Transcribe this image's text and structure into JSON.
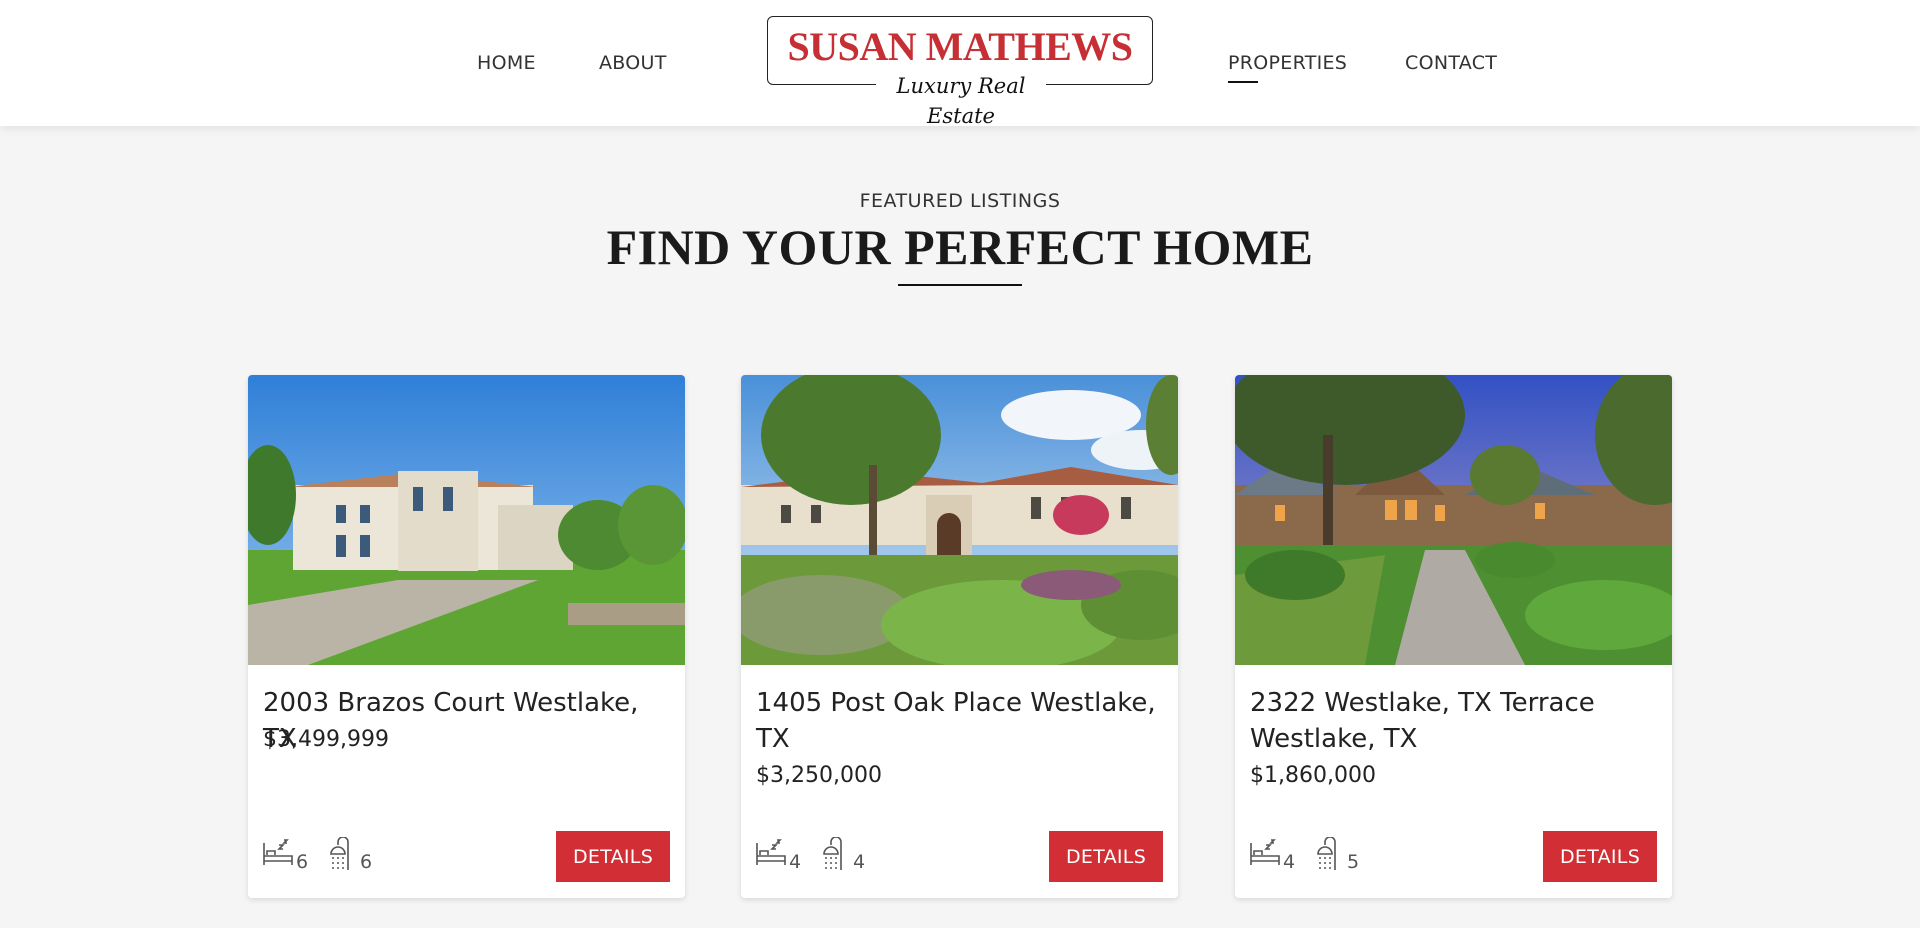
{
  "nav": {
    "home": "HOME",
    "about": "ABOUT",
    "properties": "PROPERTIES",
    "contact": "CONTACT"
  },
  "logo": {
    "name": "SUSAN MATHEWS",
    "tagline": "Luxury Real Estate",
    "brand_color": "#c62f33"
  },
  "section": {
    "eyebrow": "FEATURED LISTINGS",
    "headline": "FIND YOUR PERFECT HOME"
  },
  "accent_color": "#d12f35",
  "listings": [
    {
      "title": "2003 Brazos Court Westlake, TX",
      "price": "$3,499,999",
      "beds": "6",
      "baths": "6",
      "button": "DETAILS",
      "photo": "house-photo"
    },
    {
      "title": "1405 Post Oak Place Westlake, TX",
      "price": "$3,250,000",
      "beds": "4",
      "baths": "4",
      "button": "DETAILS",
      "photo": "house-photo"
    },
    {
      "title": "2322 Westlake, TX Terrace Westlake, TX",
      "price": "$1,860,000",
      "beds": "4",
      "baths": "5",
      "button": "DETAILS",
      "photo": "house-photo"
    }
  ]
}
